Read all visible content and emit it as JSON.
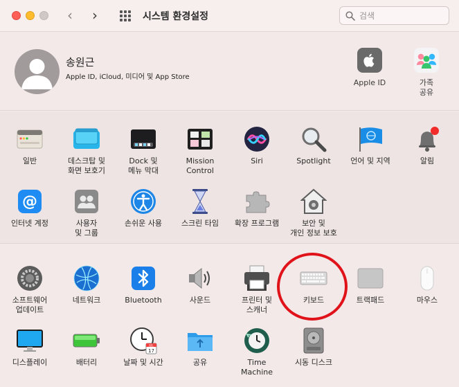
{
  "window": {
    "title": "시스템 환경설정",
    "back": "‹",
    "forward": "›"
  },
  "search": {
    "placeholder": "검색",
    "value": ""
  },
  "account": {
    "name": "송원근",
    "subtitle": "Apple ID, iCloud, 미디어 및 App Store",
    "items": [
      {
        "label": "Apple ID",
        "icon": "apple-icon"
      },
      {
        "label": "가족\n공유",
        "icon": "family-sharing-icon"
      }
    ]
  },
  "panes_row1": [
    {
      "label": "일반",
      "icon": "general-icon"
    },
    {
      "label": "데스크탑 및\n화면 보호기",
      "icon": "desktop-icon"
    },
    {
      "label": "Dock 및\n메뉴 막대",
      "icon": "dock-icon"
    },
    {
      "label": "Mission\nControl",
      "icon": "mission-control-icon"
    },
    {
      "label": "Siri",
      "icon": "siri-icon"
    },
    {
      "label": "Spotlight",
      "icon": "spotlight-icon"
    },
    {
      "label": "언어 및 지역",
      "icon": "language-region-icon"
    },
    {
      "label": "알림",
      "icon": "notifications-icon"
    }
  ],
  "panes_row2": [
    {
      "label": "인터넷 계정",
      "icon": "internet-accounts-icon"
    },
    {
      "label": "사용자\n및 그룹",
      "icon": "users-groups-icon"
    },
    {
      "label": "손쉬운 사용",
      "icon": "accessibility-icon"
    },
    {
      "label": "스크린 타임",
      "icon": "screen-time-icon"
    },
    {
      "label": "확장 프로그램",
      "icon": "extensions-icon"
    },
    {
      "label": "보안 및\n개인 정보 보호",
      "icon": "security-privacy-icon"
    }
  ],
  "panes_row3": [
    {
      "label": "소프트웨어\n업데이트",
      "icon": "software-update-icon"
    },
    {
      "label": "네트워크",
      "icon": "network-icon"
    },
    {
      "label": "Bluetooth",
      "icon": "bluetooth-icon"
    },
    {
      "label": "사운드",
      "icon": "sound-icon"
    },
    {
      "label": "프린터 및\n스캐너",
      "icon": "printers-icon"
    },
    {
      "label": "키보드",
      "icon": "keyboard-icon"
    },
    {
      "label": "트랙패드",
      "icon": "trackpad-icon"
    },
    {
      "label": "마우스",
      "icon": "mouse-icon"
    }
  ],
  "panes_row4": [
    {
      "label": "디스플레이",
      "icon": "displays-icon"
    },
    {
      "label": "배터리",
      "icon": "battery-icon"
    },
    {
      "label": "날짜 및 시간",
      "icon": "date-time-icon",
      "calendar_month": "JUL",
      "calendar_day": "17"
    },
    {
      "label": "공유",
      "icon": "sharing-icon"
    },
    {
      "label": "Time\nMachine",
      "icon": "time-machine-icon"
    },
    {
      "label": "시동 디스크",
      "icon": "startup-disk-icon"
    }
  ],
  "annotation": {
    "color": "#e0131a",
    "target": "키보드"
  }
}
